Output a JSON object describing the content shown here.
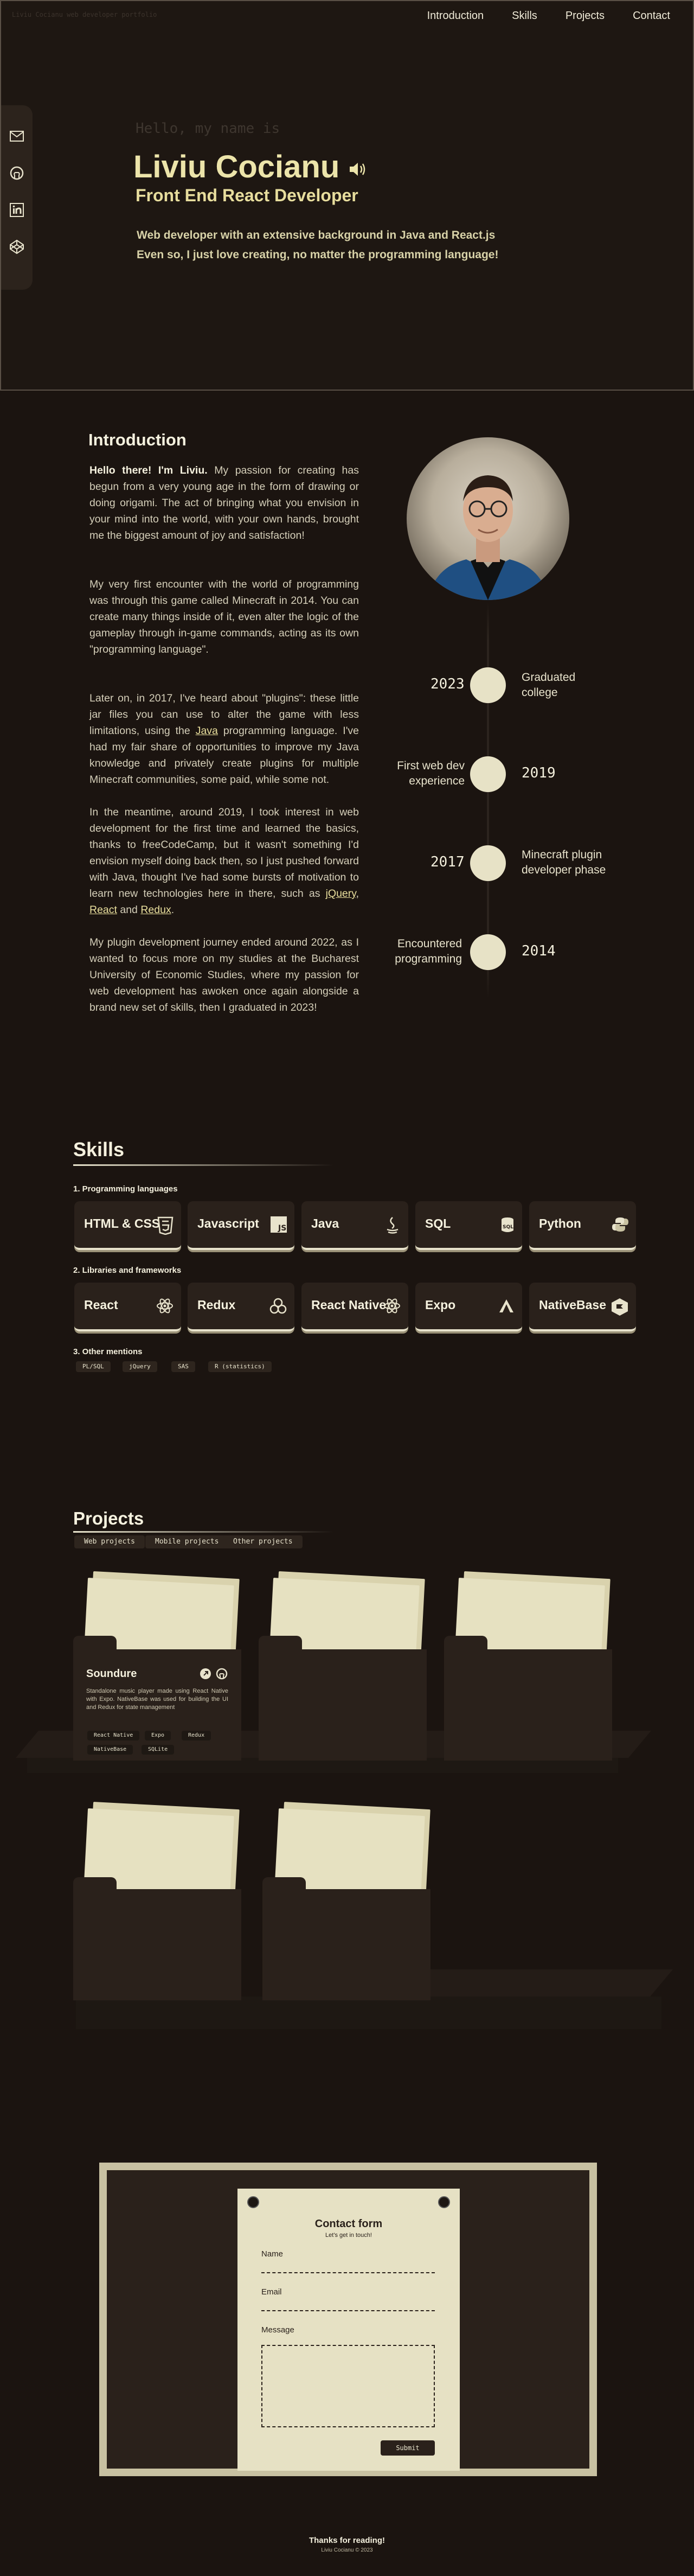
{
  "hero": {
    "breadcrumb": "Liviu Cocianu web developer portfolio",
    "nav": [
      "Introduction",
      "Skills",
      "Projects",
      "Contact"
    ],
    "greeting": "Hello, my name is",
    "name": "Liviu Cocianu",
    "role": "Front End React Developer",
    "description_1": "Web developer with an extensive background in Java and React.js",
    "description_2": "Even so, I just love creating, no matter the programming language!",
    "social": [
      "mail-icon",
      "github-icon",
      "linkedin-icon",
      "codepen-icon"
    ]
  },
  "intro": {
    "title": "Introduction",
    "p1_bold": "Hello there! I'm Liviu.",
    "p1": " My passion for creating has begun from a very young age in the form of drawing or doing origami. The act of bringing what you envision in your mind into the world, with your own hands, brought me the biggest amount of joy and satisfaction!",
    "p2": "My very first encounter with the world of programming was through this game called Minecraft in 2014. You can create many things inside of it, even alter the logic of the gameplay through in-game commands, acting as its own \"programming language\".",
    "p3a": "Later on, in 2017, I've heard about \"plugins\": these little jar files you can use to alter the game with less limitations, using the ",
    "p3_link": "Java",
    "p3b": " programming language. I've had my fair share of opportunities to improve my Java knowledge and privately create plugins for multiple Minecraft communities, some paid, while some not.",
    "p4a": "In the meantime, around 2019, I took interest in web development for the first time and learned the basics, thanks to freeCodeCamp, but it wasn't something I'd envision myself doing back then, so I just pushed forward with Java, thought I've had some bursts of motivation to learn new technologies here in there, such as ",
    "p4_l1": "jQuery",
    "p4_sep1": ", ",
    "p4_l2": "React",
    "p4_sep2": " and ",
    "p4_l3": "Redux",
    "p4_end": ".",
    "p5": "My plugin development journey ended around 2022, as I wanted to focus more on my studies at the Bucharest University of Economic Studies, where my passion for web development has awoken once again alongside a brand new set of skills, then I graduated in 2023!",
    "timeline": [
      {
        "year": "2023",
        "label": "Graduated college"
      },
      {
        "year": "2019",
        "label": "First web dev experience"
      },
      {
        "year": "2017",
        "label": "Minecraft plugin developer phase"
      },
      {
        "year": "2014",
        "label": "Encountered programming"
      }
    ]
  },
  "skills": {
    "title": "Skills",
    "cat1": "1. Programming languages",
    "cat2": "2. Libraries and frameworks",
    "cat3": "3. Other mentions",
    "languages": [
      {
        "name": "HTML & CSS",
        "icon": "html-icon"
      },
      {
        "name": "Javascript",
        "icon": "javascript-icon"
      },
      {
        "name": "Java",
        "icon": "java-icon"
      },
      {
        "name": "SQL",
        "icon": "database-icon"
      },
      {
        "name": "Python",
        "icon": "python-icon"
      }
    ],
    "libraries": [
      {
        "name": "React",
        "icon": "react-icon"
      },
      {
        "name": "Redux",
        "icon": "redux-icon"
      },
      {
        "name": "React Native",
        "icon": "react-icon"
      },
      {
        "name": "Expo",
        "icon": "expo-icon"
      },
      {
        "name": "NativeBase",
        "icon": "nativebase-icon"
      }
    ],
    "others": [
      "PL/SQL",
      "jQuery",
      "SAS",
      "R (statistics)"
    ]
  },
  "projects": {
    "title": "Projects",
    "tabs": [
      "Web projects",
      "Mobile projects",
      "Other projects"
    ],
    "featured": {
      "title": "Soundure",
      "description": "Standalone music player made using React Native with Expo. NativeBase was used for building the UI and Redux for state management",
      "tags": [
        "React Native",
        "Expo",
        "Redux",
        "NativeBase",
        "SQLite"
      ]
    }
  },
  "contact": {
    "title": "Contact form",
    "subtitle": "Let's get in touch!",
    "name_label": "Name",
    "email_label": "Email",
    "message_label": "Message",
    "submit": "Submit"
  },
  "footer": {
    "thanks": "Thanks for reading!",
    "copyright": "Liviu Cocianu © 2023"
  }
}
